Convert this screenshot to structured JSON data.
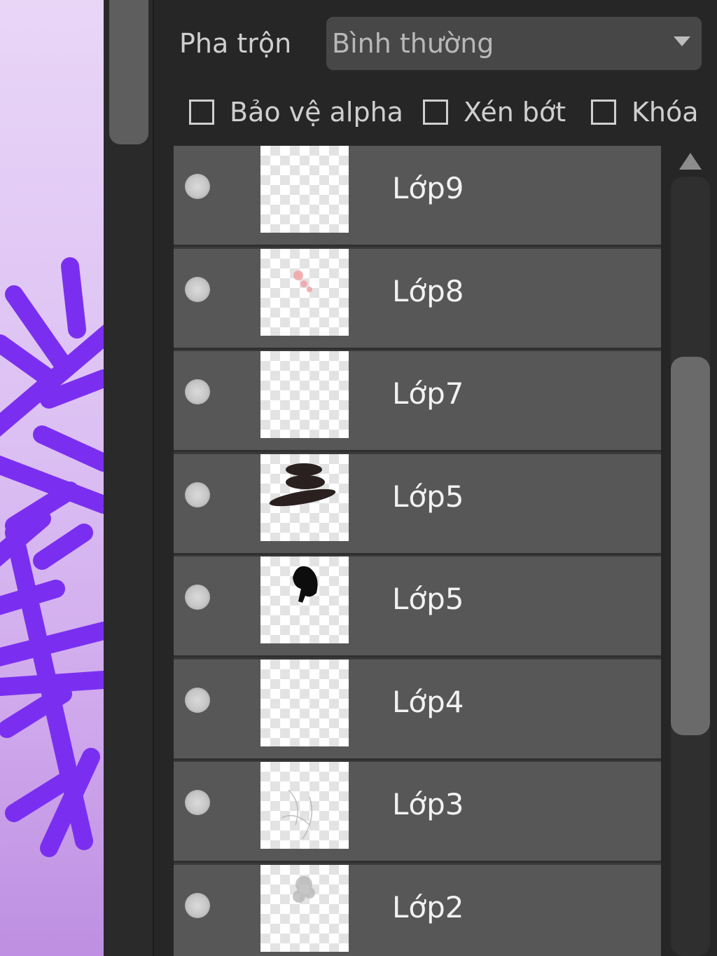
{
  "blend": {
    "label": "Pha trộn",
    "value": "Bình thường"
  },
  "options": {
    "protect_alpha": "Bảo vệ alpha",
    "clipping": "Xén bớt",
    "lock": "Khóa"
  },
  "layers": [
    {
      "name": "Lớp9",
      "thumbnail": "empty"
    },
    {
      "name": "Lớp8",
      "thumbnail": "pink-dabs"
    },
    {
      "name": "Lớp7",
      "thumbnail": "empty"
    },
    {
      "name": "Lớp5",
      "thumbnail": "hat-strokes"
    },
    {
      "name": "Lớp5",
      "thumbnail": "hair-silhouette"
    },
    {
      "name": "Lớp4",
      "thumbnail": "empty"
    },
    {
      "name": "Lớp3",
      "thumbnail": "sketch-lines"
    },
    {
      "name": "Lớp2",
      "thumbnail": "sketch-blob"
    }
  ],
  "scroll": {
    "position": 0.45
  },
  "colors": {
    "panel_bg": "#262626",
    "row_bg": "#575757",
    "text": "#f2f2f2",
    "snowflake": "#7a2ff0"
  }
}
